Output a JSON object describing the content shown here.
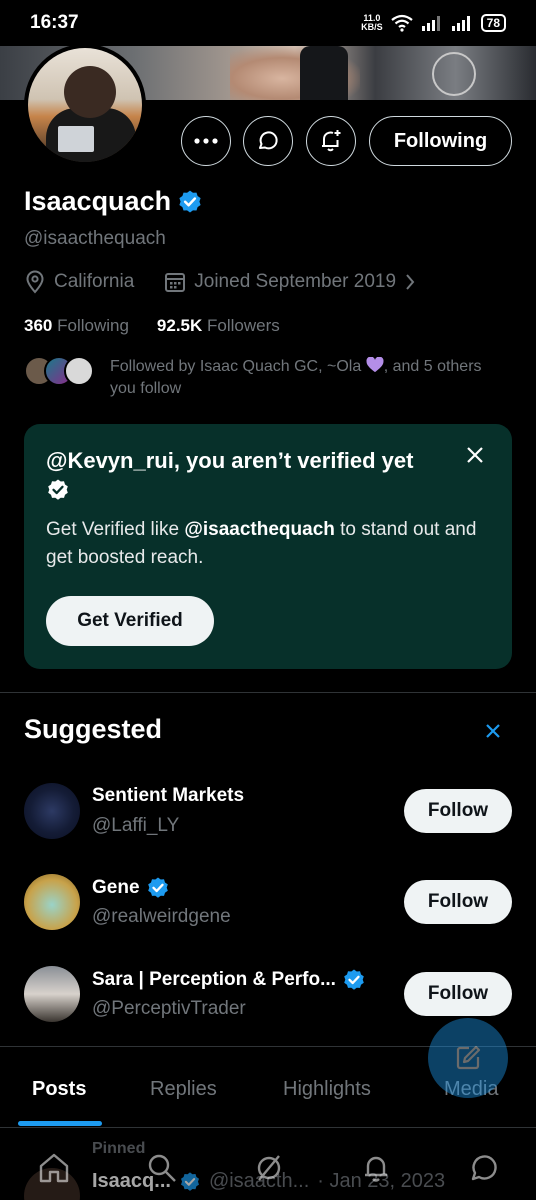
{
  "status_bar": {
    "time": "16:37",
    "net_speed": "11.0",
    "net_unit": "KB/S",
    "battery": "78"
  },
  "profile": {
    "name": "Isaacquach",
    "handle": "@isaacthequach",
    "location": "California",
    "joined": "Joined September 2019",
    "following_count": "360",
    "following_label": "Following",
    "followers_count": "92.5K",
    "followers_label": "Followers",
    "followed_by": "Followed by Isaac Quach GC, ~Ola",
    "followed_by_tail": ", and 5 others you follow",
    "follow_button": "Following"
  },
  "verify_card": {
    "title": "@Kevyn_rui, you aren’t verified yet",
    "desc_prefix": "Get Verified like ",
    "desc_handle": "@isaacthequach",
    "desc_suffix": " to stand out and get boosted reach.",
    "cta": "Get Verified"
  },
  "suggested": {
    "title": "Suggested",
    "items": [
      {
        "name": "Sentient Markets",
        "handle": "@Laffi_LY",
        "button": "Follow",
        "verified": false
      },
      {
        "name": "Gene",
        "handle": "@realweirdgene",
        "button": "Follow",
        "verified": true
      },
      {
        "name": "Sara | Perception & Perfo...",
        "handle": "@PerceptivTrader",
        "button": "Follow",
        "verified": true
      }
    ]
  },
  "tabs": [
    "Posts",
    "Replies",
    "Highlights",
    "Media"
  ],
  "pinned_post": {
    "label": "Pinned",
    "name": "Isaacq...",
    "handle": "@isaacth...",
    "date": "· Jan 23, 2023"
  },
  "colors": {
    "accent": "#1d9bf0",
    "card_bg": "#07302a",
    "muted": "#71767b"
  }
}
